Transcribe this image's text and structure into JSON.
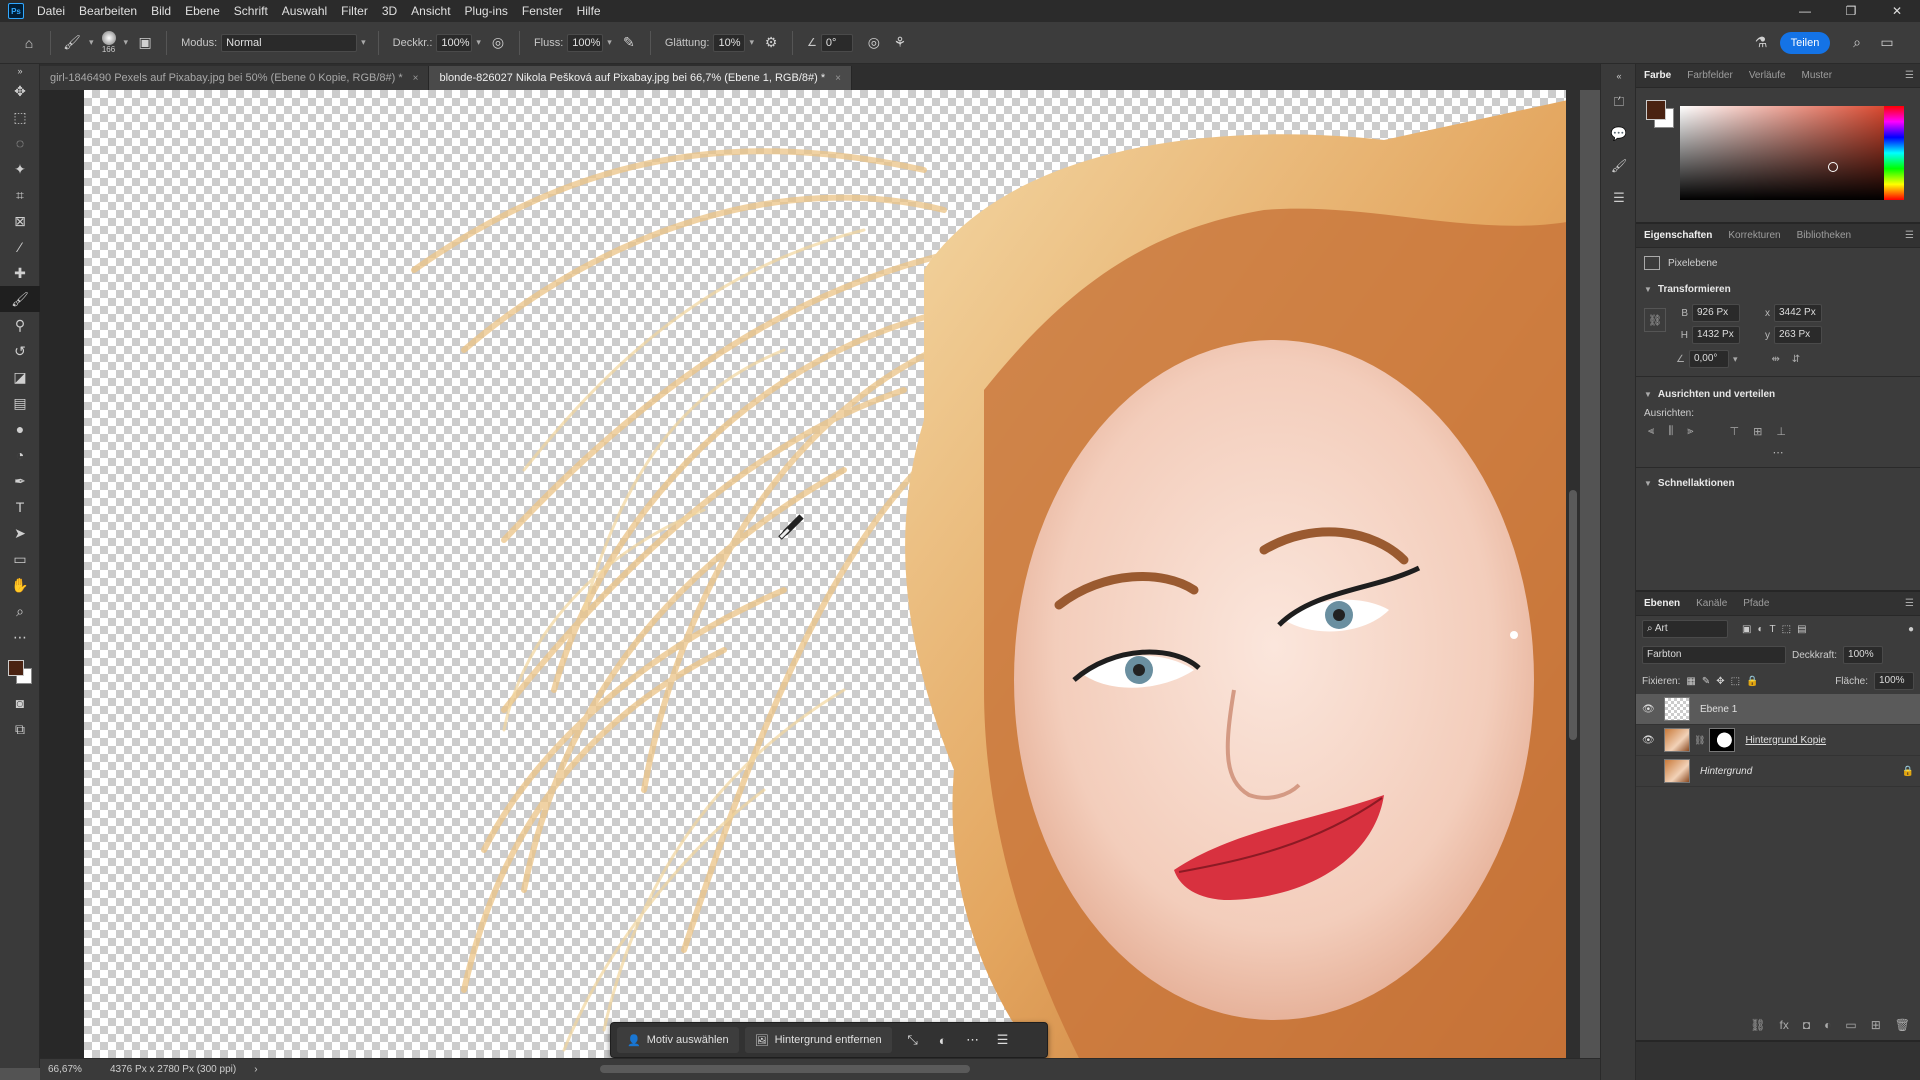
{
  "menubar": {
    "logo": "Ps",
    "items": [
      "Datei",
      "Bearbeiten",
      "Bild",
      "Ebene",
      "Schrift",
      "Auswahl",
      "Filter",
      "3D",
      "Ansicht",
      "Plug-ins",
      "Fenster",
      "Hilfe"
    ],
    "window_controls": [
      "—",
      "❐",
      "✕"
    ]
  },
  "options": {
    "brush_size": "166",
    "mode_label": "Modus:",
    "mode_value": "Normal",
    "opacity_label": "Deckkr.:",
    "opacity_value": "100%",
    "flow_label": "Fluss:",
    "flow_value": "100%",
    "smoothing_label": "Glättung:",
    "smoothing_value": "10%",
    "angle_value": "0°",
    "share_label": "Teilen"
  },
  "tabs": [
    {
      "label": "girl-1846490 Pexels auf Pixabay.jpg bei 50% (Ebene 0 Kopie, RGB/8#) *",
      "close": "×"
    },
    {
      "label": "blonde-826027 Nikola Pešková auf Pixabay.jpg bei 66,7% (Ebene 1, RGB/8#) *",
      "close": "×"
    }
  ],
  "taskbar": {
    "select_subject": "Motiv auswählen",
    "remove_background": "Hintergrund entfernen"
  },
  "status": {
    "zoom": "66,67%",
    "doc_info": "4376 Px x 2780 Px (300 ppi)"
  },
  "color_panel": {
    "tabs": [
      "Farbe",
      "Farbfelder",
      "Verläufe",
      "Muster"
    ],
    "foreground": "#4a2312",
    "background": "#ffffff"
  },
  "properties": {
    "tabs": [
      "Eigenschaften",
      "Korrekturen",
      "Bibliotheken"
    ],
    "type": "Pixelebene",
    "transform_title": "Transformieren",
    "w_label": "B",
    "w_value": "926 Px",
    "x_label": "x",
    "x_value": "3442 Px",
    "h_label": "H",
    "h_value": "1432 Px",
    "y_label": "y",
    "y_value": "263 Px",
    "angle_value": "0,00°",
    "align_title": "Ausrichten und verteilen",
    "align_label": "Ausrichten:",
    "quick_title": "Schnellaktionen"
  },
  "layers": {
    "tabs": [
      "Ebenen",
      "Kanäle",
      "Pfade"
    ],
    "filter_kind": "Art",
    "blend_mode": "Farbton",
    "opacity_label": "Deckkraft:",
    "opacity_value": "100%",
    "lock_label": "Fixieren:",
    "fill_label": "Fläche:",
    "fill_value": "100%",
    "items": [
      {
        "name": "Ebene 1"
      },
      {
        "name": "Hintergrund Kopie"
      },
      {
        "name": "Hintergrund"
      }
    ]
  }
}
